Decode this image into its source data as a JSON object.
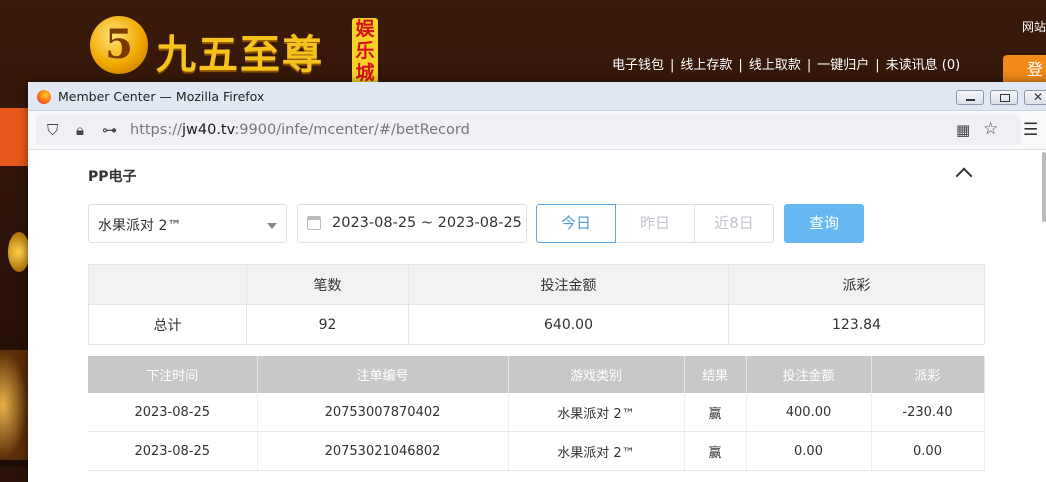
{
  "site": {
    "logo_digit": "5",
    "logo_text": "九五至尊",
    "logo_tag": [
      "娱",
      "乐",
      "城"
    ],
    "nav": [
      "电子钱包",
      "线上存款",
      "线上取款",
      "一键归户",
      "未读讯息 (0)"
    ],
    "corner_text": "网站",
    "login_label": "登"
  },
  "window": {
    "title": "Member Center — Mozilla Firefox",
    "url_scheme": "https://",
    "url_host": "jw40.tv",
    "url_rest": ":9900/infe/mcenter/#/betRecord"
  },
  "page": {
    "section_title": "PP电子",
    "game_select_value": "水果派对 2™",
    "date_range": "2023-08-25 ~ 2023-08-25",
    "quick_buttons": [
      "今日",
      "昨日",
      "近8日"
    ],
    "query_label": "查询",
    "summary": {
      "headers": [
        "",
        "笔数",
        "投注金额",
        "派彩"
      ],
      "row": [
        "总计",
        "92",
        "640.00",
        "123.84"
      ]
    },
    "records": {
      "headers": [
        "下注时间",
        "注单编号",
        "游戏类别",
        "结果",
        "投注金额",
        "派彩"
      ],
      "rows": [
        [
          "2023-08-25",
          "20753007870402",
          "水果派对 2™",
          "赢",
          "400.00",
          "-230.40"
        ],
        [
          "2023-08-25",
          "20753021046802",
          "水果派对 2™",
          "赢",
          "0.00",
          "0.00"
        ]
      ]
    }
  },
  "colors": {
    "accent": "#4a9ad6",
    "query_button": "#66b8f2",
    "negative": "#e23b3b"
  }
}
